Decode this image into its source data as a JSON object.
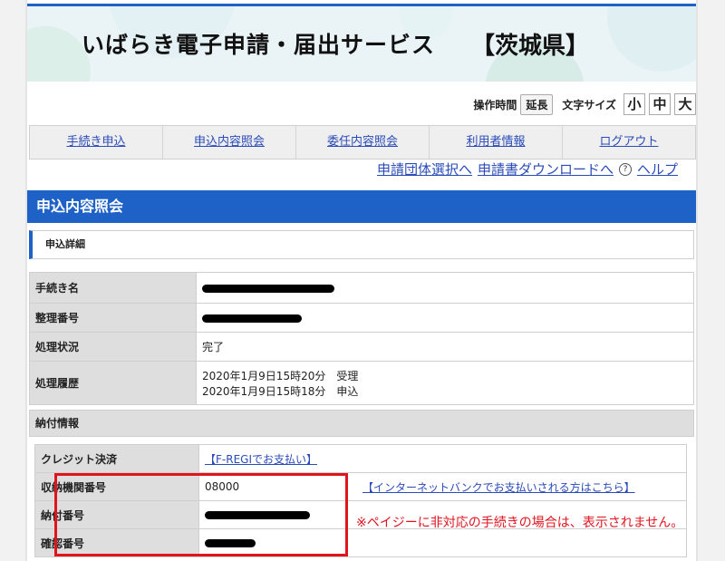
{
  "header": {
    "title": "いばらき電子申請・届出サービス",
    "prefecture": "【茨城県】"
  },
  "tools": {
    "op_time_label": "操作時間",
    "extend_label": "延長",
    "font_size_label": "文字サイズ",
    "sizes": [
      "小",
      "中",
      "大"
    ]
  },
  "nav": {
    "items": [
      "手続き申込",
      "申込内容照会",
      "委任内容照会",
      "利用者情報",
      "ログアウト"
    ]
  },
  "sublinks": {
    "group_select": "申請団体選択へ",
    "download": "申請書ダウンロードへ",
    "help": "ヘルプ"
  },
  "section": {
    "title": "申込内容照会",
    "subtitle": "申込詳細"
  },
  "detail": {
    "procedure_label": "手続き名",
    "ref_label": "整理番号",
    "status_label": "処理状況",
    "status_value": "完了",
    "history_label": "処理履歴",
    "history": [
      "2020年1月9日15時20分　受理",
      "2020年1月9日15時18分　申込"
    ]
  },
  "payment": {
    "title": "納付情報",
    "credit_label": "クレジット決済",
    "credit_link": "【F-REGIでお支払い】",
    "agency_label": "収納機関番号",
    "agency_value": "08000",
    "bank_link": "【インターネットバンクでお支払いされる方はこちら】",
    "pay_no_label": "納付番号",
    "confirm_label": "確認番号",
    "note": "※ペイジーに非対応の手続きの場合は、表示されません。"
  },
  "colors": {
    "accent": "#1e62c8",
    "highlight": "#e1141e",
    "link": "#2a4bb8"
  }
}
